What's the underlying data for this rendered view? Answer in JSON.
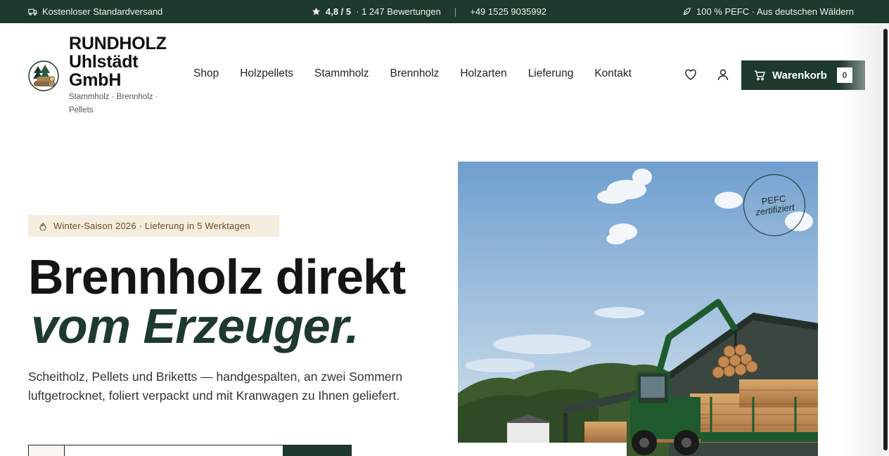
{
  "topbar": {
    "shipping": "Kostenloser Standardversand",
    "rating": "4,8 / 5",
    "reviews": "· 1 247 Bewertungen",
    "separator": "|",
    "phone": "+49 1525 9035992",
    "pefc": "100 % PEFC · Aus deutschen Wäldern"
  },
  "brand": {
    "name": "RUNDHOLZ Uhlstädt GmbH",
    "tagline": "Stammholz · Brennholz · Pellets"
  },
  "nav": {
    "items": [
      "Shop",
      "Holzpellets",
      "Stammholz",
      "Brennholz",
      "Holzarten",
      "Lieferung",
      "Kontakt"
    ]
  },
  "cart": {
    "label": "Warenkorb",
    "count": "0"
  },
  "hero": {
    "badge": "Winter-Saison 2026 · Lieferung in 5 Werktagen",
    "title_line1": "Brennholz direkt",
    "title_line2": "vom Erzeuger.",
    "lead": "Scheitholz, Pellets und Briketts — handgespalten, an zwei Sommern luftgetrocknet, foliert verpackt und mit Kranwagen zu Ihnen geliefert.",
    "seal_line1": "PEFC",
    "seal_line2": "zertifiziert"
  },
  "icons": {
    "shipping": "truck-icon",
    "rating": "star-icon",
    "pefc": "leaf-icon",
    "wishlist": "heart-icon",
    "account": "user-icon",
    "cart": "cart-icon",
    "badge": "flame-icon"
  },
  "colors": {
    "brand_green": "#1d3a2c",
    "badge_bg": "#f5eddd",
    "badge_text": "#6a4a2a"
  }
}
